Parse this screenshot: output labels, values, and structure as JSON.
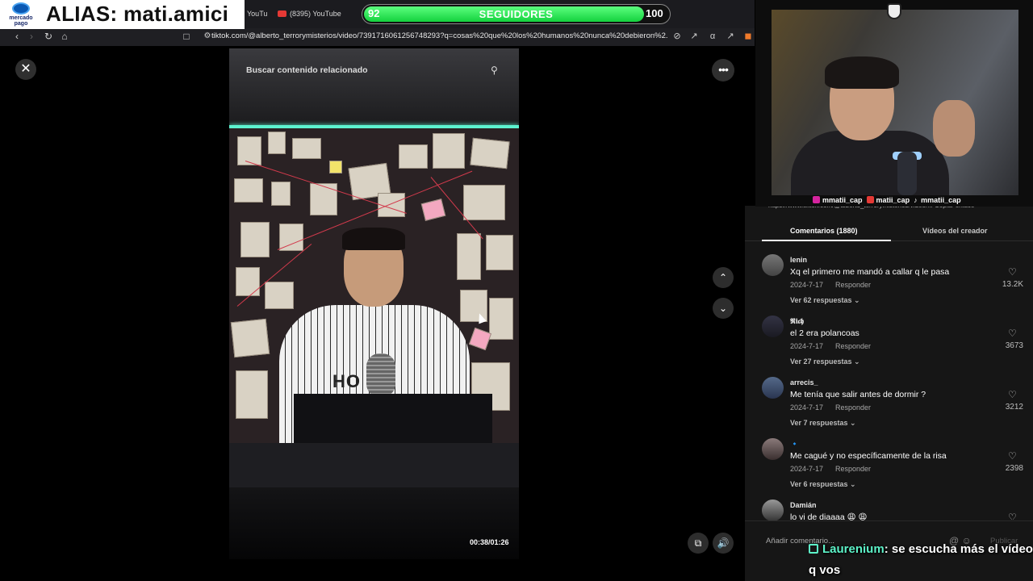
{
  "browser": {
    "tabs": [
      "YouTu",
      "(8395) YouTube"
    ],
    "url": "tiktok.com/@alberto_terrorymisterios/video/7391716061256748293?q=cosas%20que%20los%20humanos%20nunca%20debieron%2..."
  },
  "alias_overlay": {
    "logo_text": "mercado pago",
    "alias": "ALIAS: mati.amici"
  },
  "followers_goal": {
    "current": "92",
    "label": "SEGUIDORES",
    "target": "100",
    "progress_fraction": 0.92
  },
  "player": {
    "close_label": "✕",
    "more_label": "•••",
    "search_placeholder": "Buscar contenido relacionado",
    "shirt_text": "HO  ON",
    "time": "00:38/01:26",
    "up_label": "⌃",
    "down_label": "⌄",
    "volume_label": "🔊",
    "captions_label": "⧉"
  },
  "comments_panel": {
    "cut_text": "https://www.tiktok.com/@alberto_terrorymisterios/video/... Copiar enlace",
    "tab_comments": "Comentarios (1880)",
    "tab_creator": "Vídeos del creador",
    "add_comment": "Añadir comentario...",
    "post": "Publicar",
    "input_icons": "@ ☺",
    "reply_label": "Responder",
    "comments": [
      {
        "user": "lenin",
        "text": "Xq el primero me mandó a callar q le pasa",
        "date": "2024-7-17",
        "likes": "13.2K",
        "more": "Ver 62 respuestas ⌄"
      },
      {
        "user": "𝕽𝖎𝖈𝖍",
        "text": "el 2 era polancoas",
        "date": "2024-7-17",
        "likes": "3673",
        "more": "Ver 27 respuestas ⌄"
      },
      {
        "user": "arrecis_",
        "text": "Me tenía que salir antes de dormir ?",
        "date": "2024-7-17",
        "likes": "3212",
        "more": "Ver 7 respuestas ⌄"
      },
      {
        "user": "🔹",
        "text": "Me cagué y no específicamente de la risa",
        "date": "2024-7-17",
        "likes": "2398",
        "more": "Ver 6 respuestas ⌄"
      },
      {
        "user": "Damián",
        "text": "lo vi de diaaaa 😩 😩",
        "date": "",
        "likes": "",
        "more": ""
      }
    ]
  },
  "webcam": {
    "socials": [
      "mmatii_cap",
      "matii_cap",
      "mmatii_cap"
    ]
  },
  "chat_overlay": {
    "user": "Laurenium",
    "message": ": se escucha más el vídeo q vos"
  },
  "colors": {
    "goal_green": "#14d13e",
    "chat_accent": "#5df3c8",
    "youtube_red": "#e53935"
  }
}
